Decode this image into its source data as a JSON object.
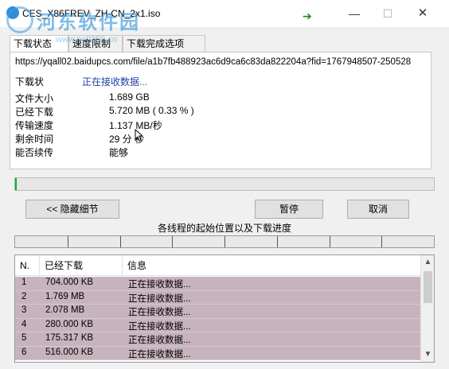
{
  "window": {
    "title": "CES_X86FREV_ZH-CN_2x1.iso",
    "minimize_glyph": "—",
    "maximize_glyph": "☐",
    "close_glyph": "✕"
  },
  "watermark": {
    "text": "河东软件园",
    "url": "www.pc0359.cn"
  },
  "tabs": [
    {
      "label": "下载状态"
    },
    {
      "label": "速度限制"
    },
    {
      "label": "下载完成选项"
    }
  ],
  "details": {
    "url": "https://yqall02.baidupcs.com/file/a1b7fb488923ac6d9ca6c83da822204a?fid=1767948507-250528",
    "status_label": "下载状",
    "status_value": "正在接收数据...",
    "rows": [
      {
        "label": "文件大小",
        "value": "1.689  GB"
      },
      {
        "label": "已经下载",
        "value": "5.720  MB  ( 0.33 % )"
      },
      {
        "label": "传输速度",
        "value": "1.137  MB/秒"
      },
      {
        "label": "剩余时间",
        "value": "29 分    秒"
      },
      {
        "label": "能否续传",
        "value": "能够"
      }
    ]
  },
  "progress": {
    "value": 0.0033
  },
  "buttons": {
    "hide": "<< 隐藏细节",
    "pause": "暂停",
    "cancel": "取消"
  },
  "threads": {
    "caption": "各线程的起始位置以及下载进度",
    "segments": 8
  },
  "list": {
    "columns": [
      "N.",
      "已经下载",
      "信息"
    ],
    "rows": [
      {
        "n": "1",
        "downloaded": "704.000  KB",
        "info": "正在接收数据..."
      },
      {
        "n": "2",
        "downloaded": "1.769  MB",
        "info": "正在接收数据..."
      },
      {
        "n": "3",
        "downloaded": "2.078  MB",
        "info": "正在接收数据..."
      },
      {
        "n": "4",
        "downloaded": "280.000  KB",
        "info": "正在接收数据..."
      },
      {
        "n": "5",
        "downloaded": "175.317  KB",
        "info": "正在接收数据..."
      },
      {
        "n": "6",
        "downloaded": "516.000  KB",
        "info": "正在接收数据..."
      }
    ]
  },
  "icons": {
    "app": "app-icon",
    "transfer": "arrow-right-icon",
    "cursor": "mouse-cursor-icon"
  },
  "colors": {
    "status_text": "#1f3fa8",
    "row_highlight": "#c7b3be",
    "transfer_arrow": "#1a8a1a"
  }
}
